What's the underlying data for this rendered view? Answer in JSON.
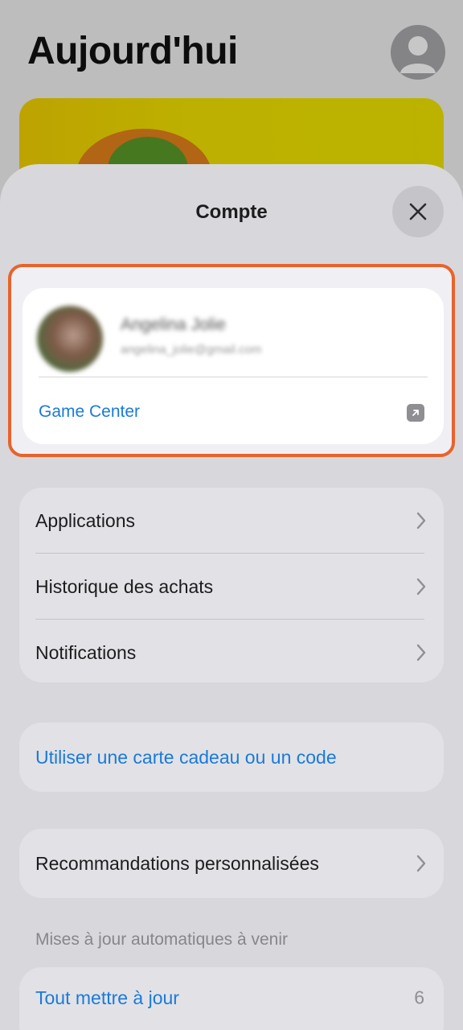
{
  "background": {
    "title": "Aujourd'hui"
  },
  "sheet": {
    "title": "Compte"
  },
  "account": {
    "name": "Angelina Jolie",
    "email": "angelina_jolie@gmail.com",
    "game_center_label": "Game Center"
  },
  "menu": {
    "items": [
      {
        "label": "Applications"
      },
      {
        "label": "Historique des achats"
      },
      {
        "label": "Notifications"
      }
    ]
  },
  "gift": {
    "label": "Utiliser une carte cadeau ou un code"
  },
  "recommendations": {
    "label": "Recommandations personnalisées"
  },
  "updates": {
    "section_label": "Mises à jour automatiques à venir",
    "update_all_label": "Tout mettre à jour",
    "count": "6"
  },
  "colors": {
    "accent": "#1a7ad9",
    "highlight": "#e8632b"
  }
}
